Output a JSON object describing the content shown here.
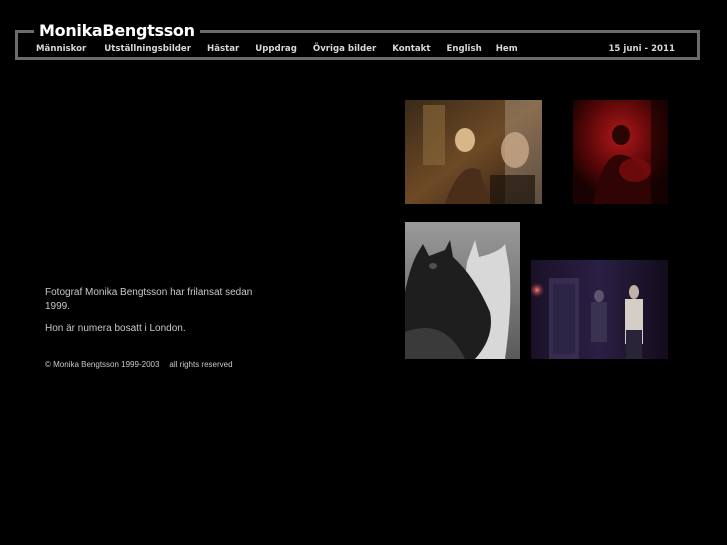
{
  "header": {
    "logo": "MonikaBengtsson",
    "date": "15 juni - 2011",
    "nav": [
      {
        "label": "Människor"
      },
      {
        "label": "Utställningsbilder"
      },
      {
        "label": "Hästar"
      },
      {
        "label": "Uppdrag"
      },
      {
        "label": "Övriga bilder"
      },
      {
        "label": "Kontakt"
      },
      {
        "label": "English"
      },
      {
        "label": "Hem"
      }
    ]
  },
  "intro": {
    "line1": "Fotograf Monika Bengtsson har frilansat sedan 1999.",
    "line2": "Hon är numera bosatt i London."
  },
  "footer": {
    "copyright": "© Monika Bengtsson 1999-2003",
    "rights": "all rights reserved"
  },
  "colors": {
    "background": "#000000",
    "frame": "#6b6b6b",
    "text": "#d8d8d8"
  }
}
